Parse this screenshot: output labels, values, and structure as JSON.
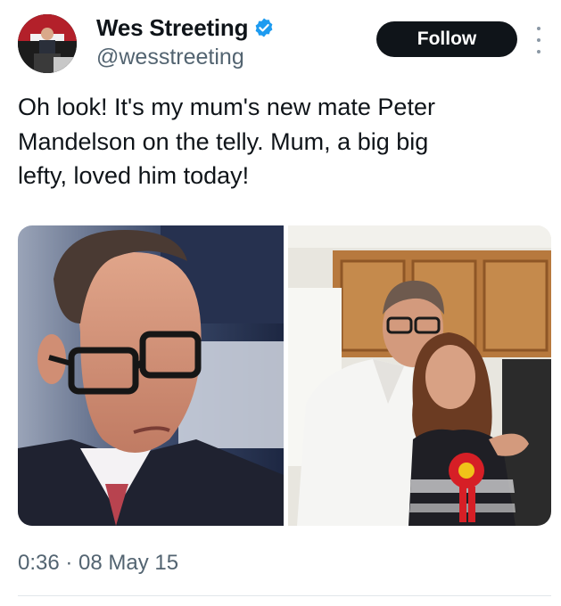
{
  "author": {
    "name": "Wes Streeting",
    "handle": "@wesstreeting",
    "verified": true,
    "avatar_icon": "profile-photo"
  },
  "actions": {
    "follow_label": "Follow",
    "more_icon": "more-vertical-icon"
  },
  "tweet": {
    "text": "Oh look! It's my mum's new mate Peter\nMandelson on the telly. Mum, a big big\nlefty, loved him today!",
    "timestamp": "0:36 · 08 May 15"
  },
  "media": [
    {
      "alt_icon": "photo-man-with-glasses-tv-studio"
    },
    {
      "alt_icon": "photo-man-and-woman-in-kitchen"
    }
  ],
  "colors": {
    "text": "#0f1419",
    "secondary": "#536471",
    "verified": "#1d9bf0",
    "follow_bg": "#0f1419"
  }
}
